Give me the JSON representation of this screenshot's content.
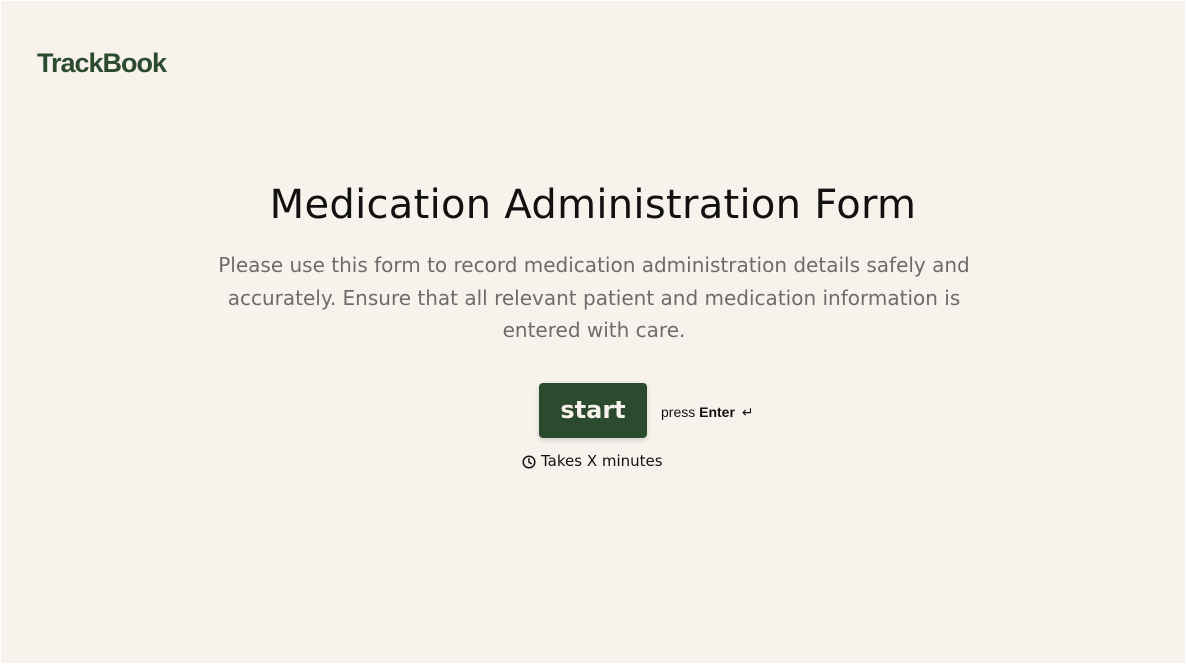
{
  "brand": {
    "logo_text": "TrackBook",
    "color": "#2c4a2e"
  },
  "colors": {
    "background": "#f7f2ec",
    "accent": "#2c4a2e",
    "muted_text": "#6e6c69"
  },
  "intro": {
    "title": "Medication Administration Form",
    "description": "Please use this form to record medication administration details safely and accurately. Ensure that all relevant patient and medication information is entered with care.",
    "start_label": "start",
    "press_label": "press",
    "key_label": "Enter",
    "enter_icon": "↵",
    "time_icon": "clock-icon",
    "time_label": "Takes X minutes"
  }
}
